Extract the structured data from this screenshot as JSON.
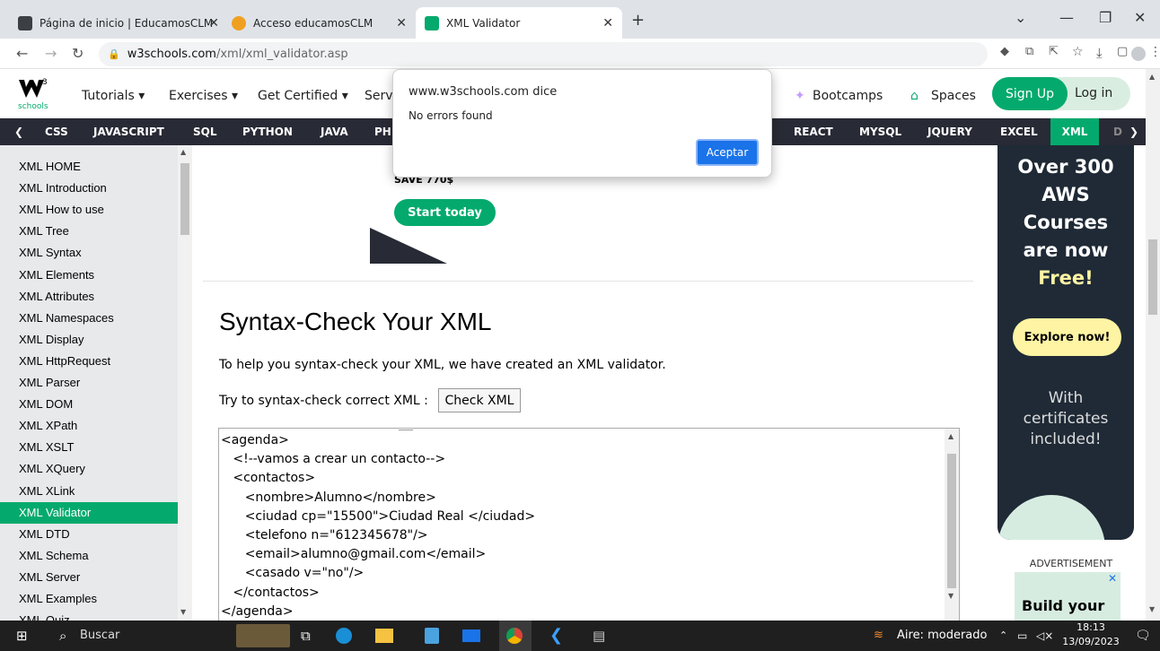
{
  "browser": {
    "tabs": [
      {
        "label": "Página de inicio | EducamosCLM",
        "color": "#3c4043"
      },
      {
        "label": "Acceso educamosCLM",
        "color": "#f0a020"
      },
      {
        "label": "XML Validator",
        "color": "#04AA6D"
      }
    ],
    "new_tab": "+",
    "window_controls": [
      "chevron-down-icon",
      "minimize-icon",
      "restore-icon",
      "close-icon"
    ],
    "url_host": "w3schools.com",
    "url_path": "/xml/xml_validator.asp"
  },
  "header": {
    "logo_sub": "schools",
    "menu": [
      "Tutorials ▾",
      "Exercises ▾",
      "Get Certified ▾",
      "Servi"
    ],
    "bootcamps": "Bootcamps",
    "spaces": "Spaces",
    "signup": "Sign Up",
    "login": "Log in"
  },
  "topnav": {
    "left_arrow": "❮",
    "links": [
      "CSS",
      "JAVASCRIPT",
      "SQL",
      "PYTHON",
      "JAVA",
      "PH",
      "REACT",
      "MYSQL",
      "JQUERY",
      "EXCEL",
      "XML",
      "D"
    ],
    "right_arrow": "❯"
  },
  "sidebar": {
    "items": [
      "XML HOME",
      "XML Introduction",
      "XML How to use",
      "XML Tree",
      "XML Syntax",
      "XML Elements",
      "XML Attributes",
      "XML Namespaces",
      "XML Display",
      "XML HttpRequest",
      "XML Parser",
      "XML DOM",
      "XML XPath",
      "XML XSLT",
      "XML XQuery",
      "XML XLink",
      "XML Validator",
      "XML DTD",
      "XML Schema",
      "XML Server",
      "XML Examples",
      "XML Quiz"
    ],
    "active": "XML Validator"
  },
  "promo": {
    "save": "SAVE 770$",
    "cta": "Start today"
  },
  "main": {
    "title": "Syntax-Check Your XML",
    "intro": "To help you syntax-check your XML, we have created an XML validator.",
    "try_label": "Try to syntax-check correct XML :",
    "check_button": "Check XML",
    "code_lines": [
      "<agenda>",
      "   <!--vamos a crear un contacto-->",
      "   <contactos>",
      "      <nombre>Alumno</nombre>",
      "      <ciudad cp=\"15500\">Ciudad Real </ciudad>",
      "      <telefono n=\"612345678\"/>",
      "      <email>alumno@gmail.com</email>",
      "      <casado v=\"no\"/>",
      "   </contactos>",
      "</agenda>"
    ]
  },
  "ad": {
    "line1": "Over 300",
    "line2": "AWS",
    "line3": "Courses",
    "line4": "are now",
    "line5": "Free!",
    "cta": "Explore now!",
    "sub1": "With",
    "sub2": "certificates",
    "sub3": "included!",
    "advertisement": "ADVERTISEMENT",
    "build": "Build your"
  },
  "dialog": {
    "origin": "www.w3schools.com dice",
    "message": "No errors found",
    "ok": "Aceptar"
  },
  "taskbar": {
    "search": "Buscar",
    "weather": "Aire: moderado",
    "time": "18:13",
    "date": "13/09/2023"
  },
  "colors": {
    "brand": "#04AA6D",
    "dark": "#282A35",
    "ok_button": "#1a73e8"
  }
}
